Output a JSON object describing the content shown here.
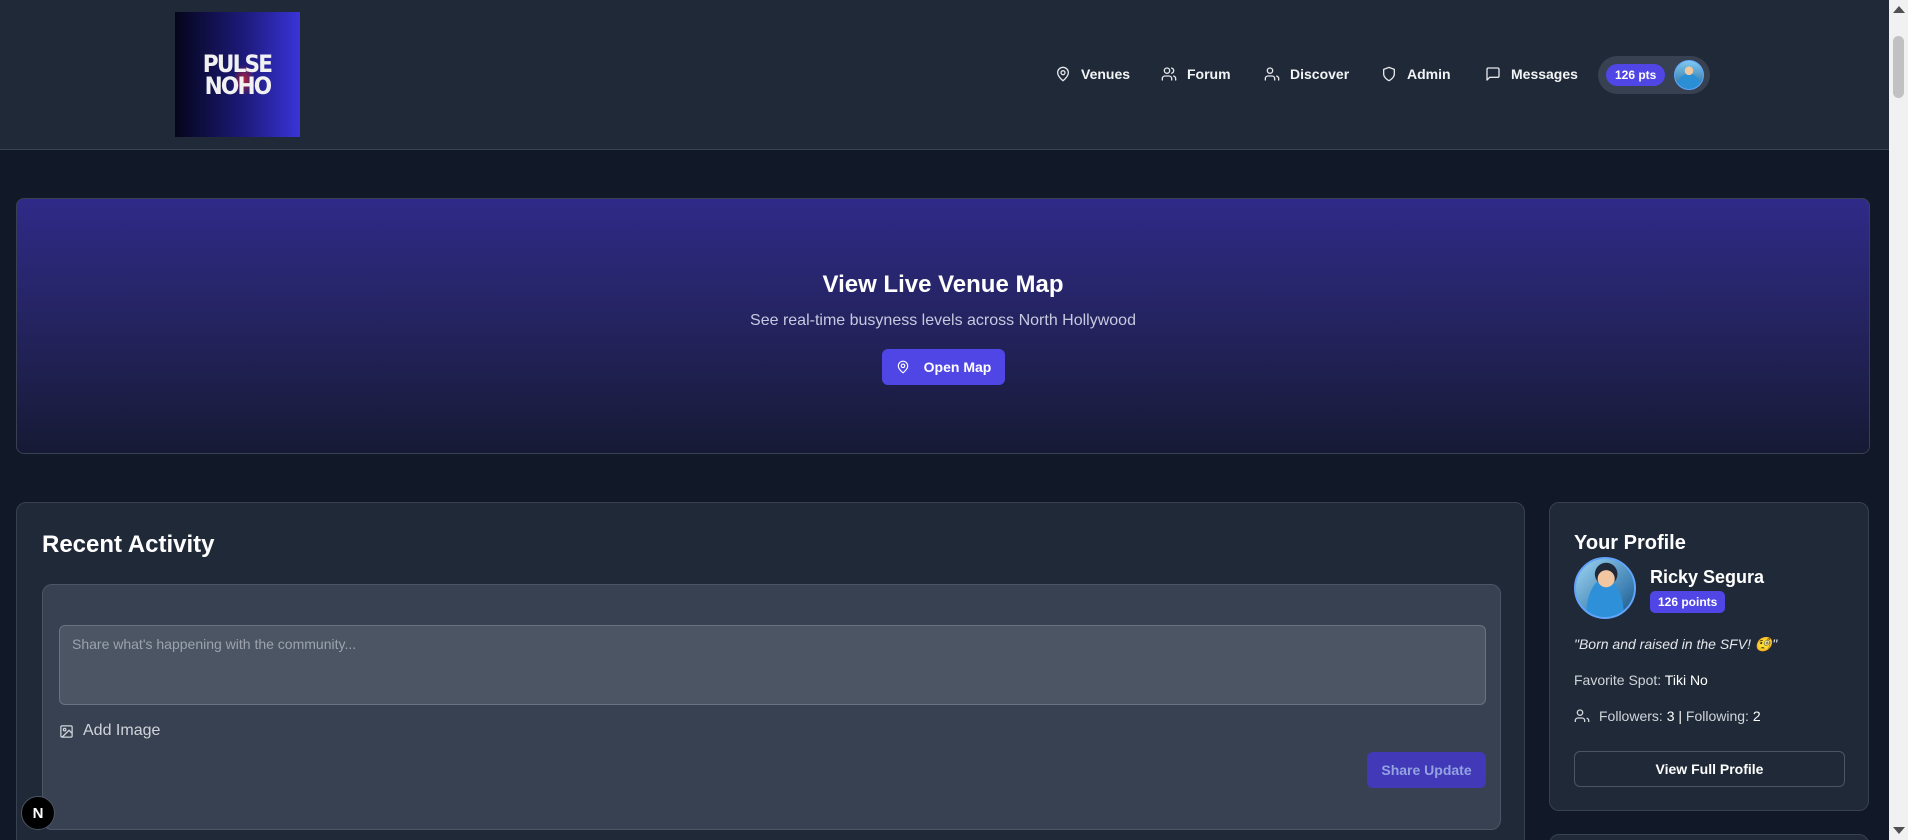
{
  "logo": {
    "line1": "PULSE",
    "line2": "NOHO"
  },
  "nav": {
    "items": [
      {
        "label": "Venues",
        "icon": "map-pin-icon"
      },
      {
        "label": "Forum",
        "icon": "users-icon"
      },
      {
        "label": "Discover",
        "icon": "user-icon"
      },
      {
        "label": "Admin",
        "icon": "shield-icon"
      },
      {
        "label": "Messages",
        "icon": "message-icon"
      }
    ],
    "points_badge": "126 pts"
  },
  "hero": {
    "title": "View Live Venue Map",
    "subtitle": "See real-time busyness levels across North Hollywood",
    "button_label": "Open Map"
  },
  "activity": {
    "title": "Recent Activity",
    "placeholder": "Share what's happening with the community...",
    "add_image_label": "Add Image",
    "share_label": "Share Update"
  },
  "profile": {
    "title": "Your Profile",
    "name": "Ricky Segura",
    "points": "126 points",
    "bio": "\"Born and raised in the SFV! 🧐\"",
    "favorite_label": "Favorite Spot:",
    "favorite_value": "Tiki No",
    "followers_label": "Followers:",
    "followers_value": "3",
    "separator": "|",
    "following_label": "Following:",
    "following_value": "2",
    "view_button": "View Full Profile"
  },
  "dev_badge": "N",
  "colors": {
    "accent": "#4f46e5",
    "background": "#111827",
    "surface": "#1f2937"
  }
}
